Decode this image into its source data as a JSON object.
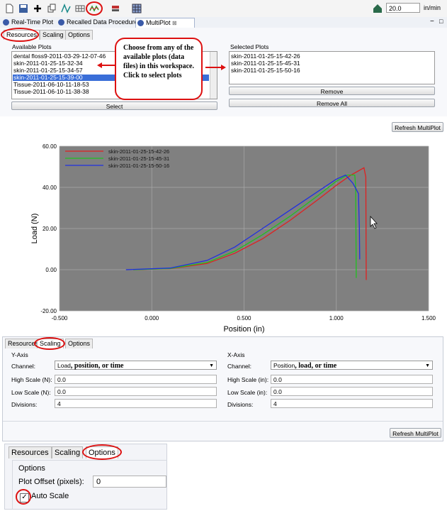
{
  "toolbar": {
    "icons": [
      "new-file-icon",
      "save-icon",
      "add-icon",
      "copy-icon",
      "waveform-icon",
      "table-icon",
      "multiplot-icon",
      "calibrate-icon",
      "grid-icon",
      "home-icon"
    ],
    "speed_value": "20.0",
    "speed_unit": "in/min"
  },
  "editor_tabs": [
    {
      "label": "Real-Time Plot"
    },
    {
      "label": "Recalled Data Procedure"
    },
    {
      "label": "MultiPlot",
      "close": "⊠"
    }
  ],
  "window_controls": {
    "minimize": "−",
    "maximize": "□"
  },
  "resources_panel": {
    "tabs": [
      "Resources",
      "Scaling",
      "Options"
    ],
    "available_label": "Available Plots",
    "available_items": [
      "dental floss9-2011-03-29-12-07-46",
      "skin-2011-01-25-15-32-34",
      "skin-2011-01-25-15-34-57",
      "skin-2011-01-25-15-39-00",
      "Tissue-2011-06-10-11-18-53",
      "Tissue-2011-06-10-11-38-38"
    ],
    "available_selected_index": 3,
    "select_button": "Select",
    "selected_label": "Selected Plots",
    "selected_items": [
      "skin-2011-01-25-15-42-26",
      "skin-2011-01-25-15-45-31",
      "skin-2011-01-25-15-50-16"
    ],
    "remove_button": "Remove",
    "remove_all_button": "Remove All",
    "annotation": "Choose from any of the available plots (data files) in this workspace. Click to select plots"
  },
  "refresh_button": "Refresh MultiPlot",
  "chart_data": {
    "type": "line",
    "title": "",
    "xlabel": "Position (in)",
    "ylabel": "Load (N)",
    "xlim": [
      -0.5,
      1.5
    ],
    "ylim": [
      -20,
      60
    ],
    "x_ticks": [
      "-0.500",
      "0.000",
      "0.500",
      "1.000",
      "1.500"
    ],
    "y_ticks": [
      "-20.00",
      "0.00",
      "20.00",
      "40.00",
      "60.00"
    ],
    "grid": true,
    "legend_position": "top-left",
    "series": [
      {
        "name": "skin-2011-01-25-15-42-26",
        "color": "#e02020",
        "x": [
          -0.1,
          0.1,
          0.3,
          0.45,
          0.6,
          0.75,
          0.9,
          1.0,
          1.08,
          1.15,
          1.16,
          1.162
        ],
        "y": [
          0,
          0.5,
          3,
          8,
          15,
          24,
          34,
          41,
          46,
          49.5,
          45,
          -5
        ]
      },
      {
        "name": "skin-2011-01-25-15-45-31",
        "color": "#20c020",
        "x": [
          -0.1,
          0.1,
          0.3,
          0.45,
          0.6,
          0.75,
          0.9,
          1.0,
          1.06,
          1.1,
          1.105,
          1.108
        ],
        "y": [
          0,
          0.6,
          3.5,
          9,
          17,
          26,
          36,
          43,
          46,
          46,
          40,
          -4
        ]
      },
      {
        "name": "skin-2011-01-25-15-50-16",
        "color": "#2030e0",
        "x": [
          -0.14,
          0.1,
          0.3,
          0.45,
          0.6,
          0.75,
          0.9,
          1.0,
          1.05,
          1.09,
          1.12,
          1.125,
          1.127
        ],
        "y": [
          0,
          0.8,
          4.5,
          11,
          20,
          29,
          38,
          44,
          46,
          42,
          37,
          20,
          5
        ]
      }
    ]
  },
  "scaling_panel": {
    "tabs": [
      "Resources",
      "Scaling",
      "Options"
    ],
    "yaxis": {
      "title": "Y-Axis",
      "channel_label": "Channel:",
      "channel_value": "Load",
      "channel_annot": ", position, or time",
      "high_label": "High Scale (N):",
      "high_value": "0.0",
      "low_label": "Low Scale (N):",
      "low_value": "0.0",
      "div_label": "Divisions:",
      "div_value": "4"
    },
    "xaxis": {
      "title": "X-Axis",
      "channel_label": "Channel:",
      "channel_value": "Position",
      "channel_annot": ", load, or time",
      "high_label": "High Scale (in):",
      "high_value": "0.0",
      "low_label": "Low Scale (in):",
      "low_value": "0.0",
      "div_label": "Divisions:",
      "div_value": "4"
    }
  },
  "options_panel": {
    "tabs": [
      "Resources",
      "Scaling",
      "Options"
    ],
    "group_title": "Options",
    "offset_label": "Plot Offset (pixels):",
    "offset_value": "0",
    "autoscale_label": "Auto Scale",
    "autoscale_checked": true
  }
}
